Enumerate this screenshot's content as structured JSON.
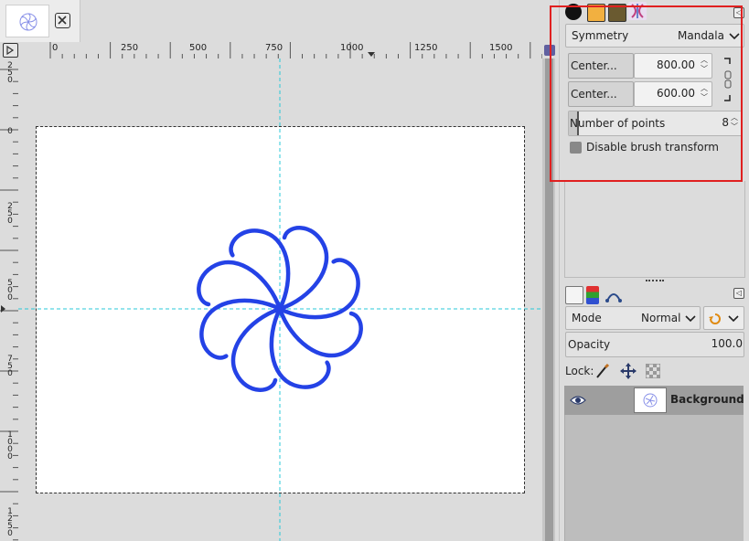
{
  "ruler": {
    "h_labels": [
      "0",
      "250",
      "500",
      "750",
      "1000",
      "1250",
      "1500"
    ],
    "v_labels": [
      "250",
      "0",
      "250",
      "500",
      "750",
      "1000",
      "1250"
    ]
  },
  "symmetry": {
    "label": "Symmetry",
    "value": "Mandala",
    "center_x_label": "Center...",
    "center_x": "800.00",
    "center_y_label": "Center...",
    "center_y": "600.00",
    "points_label": "Number of points",
    "points": "8",
    "disable_brush_label": "Disable brush transform"
  },
  "layers": {
    "mode_label": "Mode",
    "mode_value": "Normal",
    "opacity_label": "Opacity",
    "opacity_value": "100.0",
    "lock_label": "Lock:",
    "layer_name": "Background"
  },
  "colors": {
    "stroke": "#2442e6",
    "guide": "#28c8d8",
    "highlight": "#e02020"
  }
}
